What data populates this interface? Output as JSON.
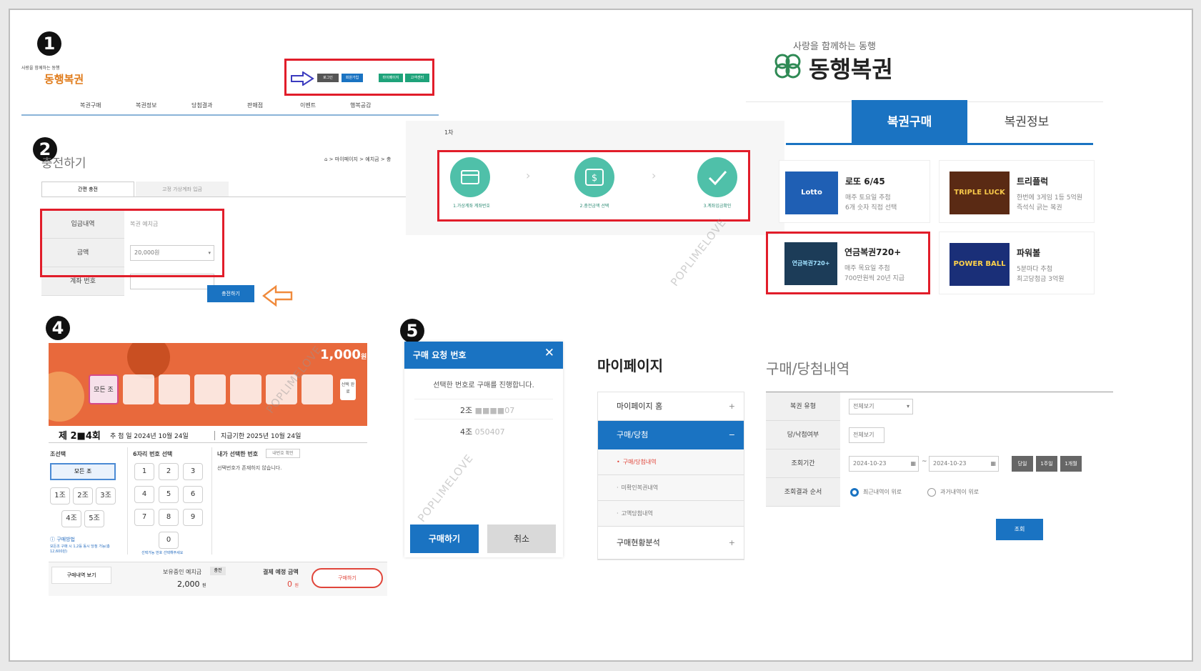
{
  "steps": {
    "s1": "1",
    "s2": "2",
    "s4": "4",
    "s5": "5"
  },
  "watermark": "POPLIMELOVE",
  "panel1": {
    "logo_tagline": "사랑을 함께하는 동행",
    "logo_name": "동행복권",
    "top_buttons": [
      "로그인",
      "회원가입",
      "마이페이지",
      "고객센터"
    ],
    "nav": [
      "복권구매",
      "복권정보",
      "당첨결과",
      "판매점",
      "이벤트",
      "행복공감"
    ]
  },
  "panel2": {
    "title": "충전하기",
    "breadcrumb": "⌂ > 마이페이지 > 예치금 > 충",
    "tabs": [
      "간편 충전",
      "고정 가상계좌 입금"
    ],
    "form": [
      {
        "label": "입금내역",
        "value": "복권 예치금"
      },
      {
        "label": "금액",
        "value": "20,000원"
      },
      {
        "label": "계좌 번호",
        "value": ""
      }
    ],
    "charge_button": "충전하기"
  },
  "panel3": {
    "label": "1차",
    "steps": [
      "1.가상계좌 계좌번호",
      "2.충전금액 선택",
      "3.계좌입금확인"
    ]
  },
  "panel_shop": {
    "logo_tagline": "사랑을 함께하는 동행",
    "logo_name": "동행복권",
    "tabs": [
      "복권구매",
      "복권정보"
    ],
    "products": [
      {
        "name": "로또 6/45",
        "desc1": "매주 토요일 추첨",
        "desc2": "6개 숫자 직접 선택",
        "badge": "Lotto"
      },
      {
        "name": "트리플럭",
        "desc1": "한번에 3게임 1등 5억원",
        "desc2": "즉석식 긁는 복권",
        "badge": "TRIPLE LUCK"
      },
      {
        "name": "연금복권720+",
        "desc1": "매주 목요일 추첨",
        "desc2": "700만원씩 20년 지급",
        "badge": "연금복권720+"
      },
      {
        "name": "파워볼",
        "desc1": "5분마다 추첨",
        "desc2": "최고당첨금 3억원",
        "badge": "POWER BALL"
      }
    ]
  },
  "panel4": {
    "price": "1,000",
    "currency": "원",
    "all_groups_chip": "모든 조",
    "select_chip": "선택 완료",
    "round_prefix": "제",
    "round_number": "2■4",
    "round_suffix": "회",
    "draw_date": "추 첨 일 2024년 10월 24일",
    "pay_deadline": "지급기한 2025년 10월 24일",
    "group_title": "조선택",
    "group_all": "모든 조",
    "groups": [
      "1조",
      "2조",
      "3조",
      "4조",
      "5조"
    ],
    "digits_title": "6자리 번호 선택",
    "digits": [
      "1",
      "2",
      "3",
      "4",
      "5",
      "6",
      "7",
      "8",
      "9",
      "0"
    ],
    "my_numbers_title": "내가 선택한 번호",
    "my_numbers_btn": "내번호 확인",
    "my_numbers_empty": "선택번호가 존재하지 않습니다.",
    "guide_title": "ⓘ 구매방법",
    "guide_text": "모든조 구매 시 1,2등 동시 당첨 가능(총 12,600원)",
    "digits_note": "선택가능 번호 선택해주세요",
    "view_history": "구매내역 보기",
    "deposit_label": "보유중인 예치금",
    "charge_chip": "충전",
    "deposit_value": "2,000",
    "deposit_unit": "원",
    "pay_label": "결제 예정 금액",
    "pay_value": "0",
    "pay_unit": "원",
    "buy_button": "구매하기"
  },
  "panel5": {
    "header": "구매 요청 번호",
    "close": "✕",
    "message": "선택한 번호로 구매를 진행합니다.",
    "rows": [
      {
        "group": "2조",
        "number": "■■■■07"
      },
      {
        "group": "4조",
        "number": "050407"
      }
    ],
    "buy": "구매하기",
    "cancel": "취소"
  },
  "mypage": {
    "title": "마이페이지",
    "items": [
      {
        "label": "마이페이지 홈",
        "icon": "+"
      },
      {
        "label": "구매/당첨",
        "icon": "−"
      }
    ],
    "sub_items": [
      "구매/당첨내역",
      "미확인복권내역",
      "고액당첨내역"
    ],
    "last_item": "구매현황분석",
    "last_icon": "+"
  },
  "history": {
    "title": "구매/당첨내역",
    "rows": [
      {
        "label": "복권 유형",
        "value": "전체보기"
      },
      {
        "label": "당/낙첨여부",
        "value": "전체보기"
      },
      {
        "label": "조회기간",
        "value": ""
      },
      {
        "label": "조회결과 순서",
        "value": ""
      }
    ],
    "date_from": "2024-10-23",
    "date_to": "2024-10-23",
    "date_sep": "~",
    "range_buttons": [
      "당일",
      "1주일",
      "1개월"
    ],
    "order_options": [
      "최근내역이 위로",
      "과거내역이 위로"
    ],
    "search": "조회"
  },
  "colors": {
    "red": "#e11d2a",
    "blue": "#1a73c2",
    "teal": "#4fc0a9",
    "orange": "#e8693c"
  }
}
